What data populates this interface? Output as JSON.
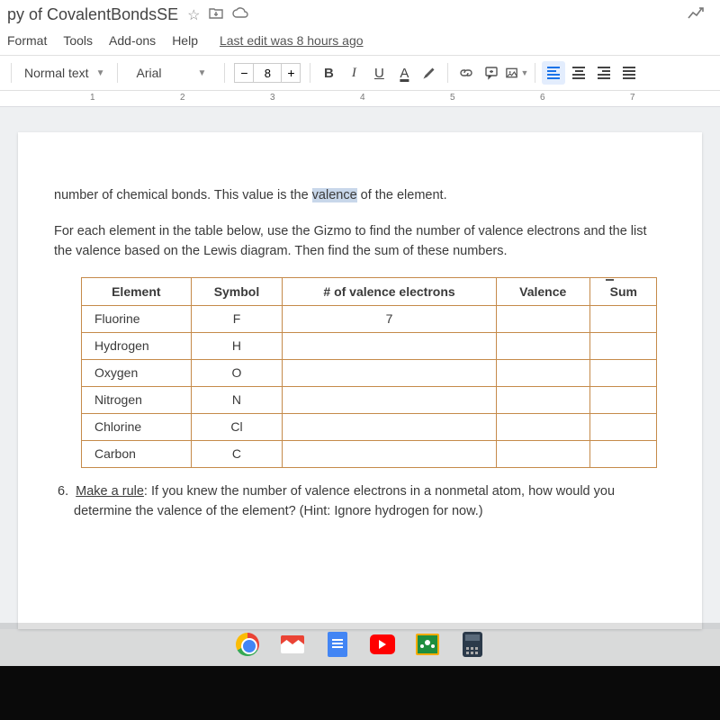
{
  "titlebar": {
    "title": "py of CovalentBondsSE"
  },
  "menubar": {
    "items": [
      "Format",
      "Tools",
      "Add-ons",
      "Help"
    ],
    "last_edit": "Last edit was 8 hours ago"
  },
  "toolbar": {
    "paragraph_style": "Normal text",
    "font": "Arial",
    "size_minus": "−",
    "font_size": "8",
    "size_plus": "+",
    "bold": "B",
    "italic": "I",
    "underline": "U",
    "text_color": "A"
  },
  "ruler": {
    "marks": [
      "1",
      "2",
      "3",
      "4",
      "5",
      "6",
      "7"
    ]
  },
  "document": {
    "para1_pre": "number of chemical bonds. This value is the ",
    "para1_hl": "valence",
    "para1_post": " of the element.",
    "para2": "For each element in the table below, use the Gizmo to find the number of valence electrons and the list the valence based on the Lewis diagram. Then find the sum of these numbers.",
    "table": {
      "headers": [
        "Element",
        "Symbol",
        "# of valence electrons",
        "Valence",
        "Sum"
      ],
      "rows": [
        {
          "element": "Fluorine",
          "symbol": "F",
          "valence_e": "7",
          "valence": "",
          "sum": ""
        },
        {
          "element": "Hydrogen",
          "symbol": "H",
          "valence_e": "",
          "valence": "",
          "sum": ""
        },
        {
          "element": "Oxygen",
          "symbol": "O",
          "valence_e": "",
          "valence": "",
          "sum": ""
        },
        {
          "element": "Nitrogen",
          "symbol": "N",
          "valence_e": "",
          "valence": "",
          "sum": ""
        },
        {
          "element": "Chlorine",
          "symbol": "Cl",
          "valence_e": "",
          "valence": "",
          "sum": ""
        },
        {
          "element": "Carbon",
          "symbol": "C",
          "valence_e": "",
          "valence": "",
          "sum": ""
        }
      ]
    },
    "q6_num": "6.",
    "q6_label": "Make a rule",
    "q6_text": ": If you knew the number of valence electrons in a nonmetal atom, how would you determine the valence of the element? (Hint: Ignore hydrogen for now.)"
  }
}
